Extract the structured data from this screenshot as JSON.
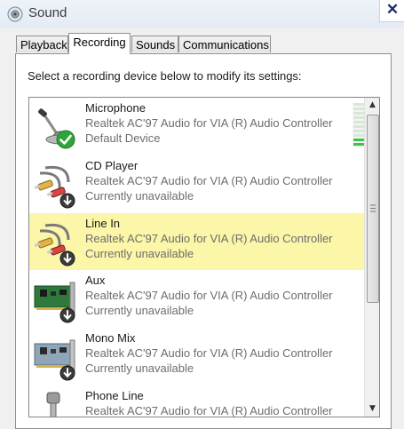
{
  "window": {
    "title": "Sound",
    "close_glyph": "✕"
  },
  "tabs": [
    {
      "label": "Playback",
      "active": false
    },
    {
      "label": "Recording",
      "active": true
    },
    {
      "label": "Sounds",
      "active": false
    },
    {
      "label": "Communications",
      "active": false
    }
  ],
  "recording": {
    "instructions": "Select a recording device below to modify its settings:",
    "devices": [
      {
        "name": "Microphone",
        "description": "Realtek AC'97 Audio for VIA (R) Audio Controller",
        "status": "Default Device",
        "icon": "microphone-icon",
        "badge": "default-check-icon",
        "selected": false
      },
      {
        "name": "CD Player",
        "description": "Realtek AC'97 Audio for VIA (R) Audio Controller",
        "status": "Currently unavailable",
        "icon": "rca-cable-icon",
        "badge": "unavailable-arrow-icon",
        "selected": false
      },
      {
        "name": "Line In",
        "description": "Realtek AC'97 Audio for VIA (R) Audio Controller",
        "status": "Currently unavailable",
        "icon": "rca-cable-icon",
        "badge": "unavailable-arrow-icon",
        "selected": true
      },
      {
        "name": "Aux",
        "description": "Realtek AC'97 Audio for VIA (R) Audio Controller",
        "status": "Currently unavailable",
        "icon": "sound-card-icon",
        "badge": "unavailable-arrow-icon",
        "selected": false
      },
      {
        "name": "Mono Mix",
        "description": "Realtek AC'97 Audio for VIA (R) Audio Controller",
        "status": "Currently unavailable",
        "icon": "sound-card-icon",
        "badge": "unavailable-arrow-icon",
        "selected": false
      },
      {
        "name": "Phone Line",
        "description": "Realtek AC'97 Audio for VIA (R) Audio Controller",
        "status": "",
        "icon": "phone-jack-icon",
        "badge": "",
        "selected": false
      }
    ],
    "microphone_level_fraction": 0.2
  },
  "colors": {
    "selection_highlight": "#fbf6a8",
    "check_green": "#2fa43a",
    "level_green": "#3cc44a"
  }
}
